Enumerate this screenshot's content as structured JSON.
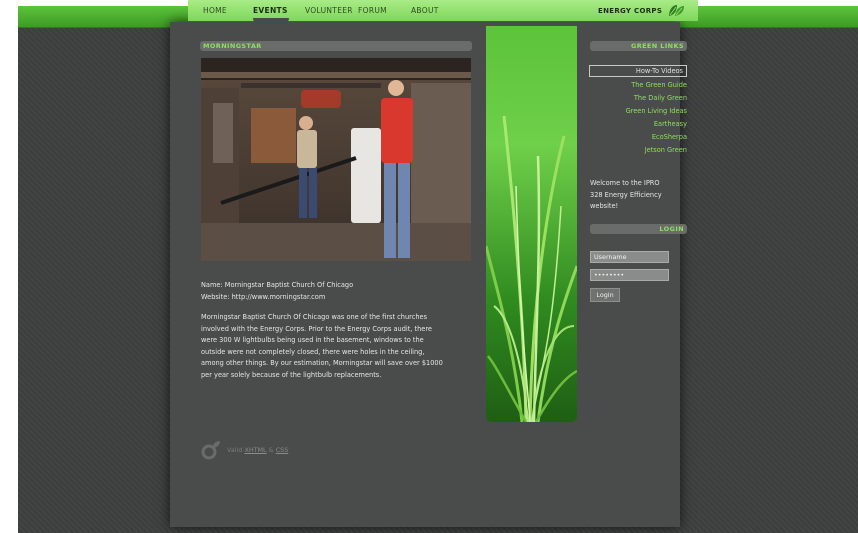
{
  "nav": {
    "items": [
      "HOME",
      "EVENTS",
      "VOLUNTEER",
      "FORUM",
      "ABOUT"
    ],
    "active": "EVENTS",
    "brand": "ENERGY CORPS",
    "logo_icon": "leaf-icon"
  },
  "main": {
    "title": "MORNINGSTAR",
    "name_line": "Name: Morningstar Baptist Church Of Chicago",
    "website_line": "Website: http://www.morningstar.com",
    "description": [
      "Morningstar Baptist Church Of Chicago was one of the first churches",
      "involved with the Energy Corps. Prior to the Energy Corps audit, there",
      "were 300 W lightbulbs being used in the basement, windows to the",
      "outside were not completely closed, there were holes in the ceiling,",
      "among other things. By our estimation, Morningstar will save over $1000",
      "per year solely because of the lightbulb replacements."
    ]
  },
  "sidebar": {
    "links_title": "GREEN LINKS",
    "links": [
      "How-To Videos",
      "The Green Guide",
      "The Daily Green",
      "Green Living Ideas",
      "Eartheasy",
      "EcoSherpa",
      "Jetson Green"
    ],
    "welcome": [
      "Welcome to the IPRO",
      "328 Energy Efficiency",
      "website!"
    ],
    "login_title": "LOGIN",
    "username_value": "Username",
    "password_value": "••••••••",
    "login_button": "Login"
  },
  "footer": {
    "prefix": "Valid",
    "xhtml": "XHTML",
    "amp": "&",
    "css": "CSS",
    "icon": "logo-mark-icon"
  },
  "colors": {
    "accent": "#8ee05f",
    "nav_bg": "#8fe06c",
    "page_bg": "#3e3f3f",
    "content_bg": "#4a4b4b"
  }
}
